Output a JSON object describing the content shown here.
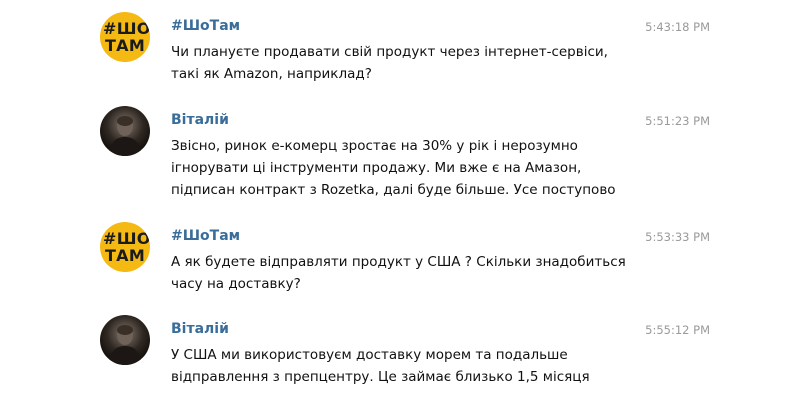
{
  "messages": [
    {
      "author": "#ШоТам",
      "avatar_text": [
        "#ШО",
        "ТАМ"
      ],
      "time": "5:43:18 PM",
      "lines": [
        "Чи плануєте продавати свій продукт через інтернет-сервіси,",
        "такі як Amazon, наприклад?"
      ]
    },
    {
      "author": "Віталій",
      "time": "5:51:23 PM",
      "lines": [
        "Звісно, ринок е-комерц зростає на 30% у рік і нерозумно",
        "ігнорувати ці інструменти продажу. Ми вже є на Амазон,",
        "підписан контракт з Rozetka, далі буде більше. Усе поступово"
      ]
    },
    {
      "author": "#ШоТам",
      "avatar_text": [
        "#ШО",
        "ТАМ"
      ],
      "time": "5:53:33 PM",
      "lines": [
        "А як будете відправляти продукт у США ? Скільки знадобиться",
        "часу на доставку?"
      ]
    },
    {
      "author": "Віталій",
      "time": "5:55:12 PM",
      "lines": [
        "У США ми використовуєм доставку морем та подальше",
        "відправлення з препцентру. Це займає близько 1,5 місяця"
      ]
    }
  ]
}
